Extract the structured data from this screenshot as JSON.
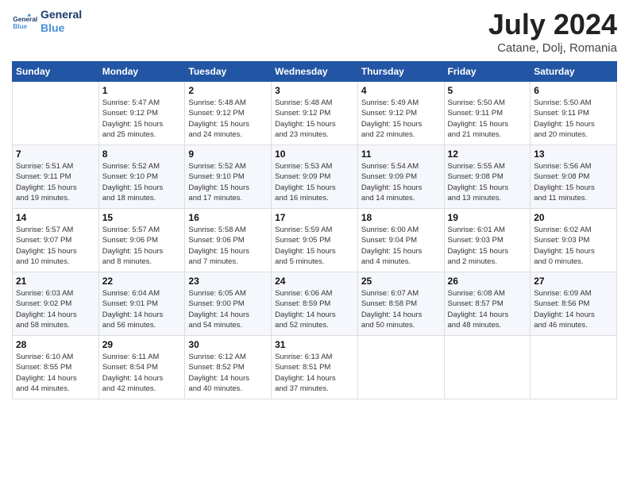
{
  "header": {
    "logo_line1": "General",
    "logo_line2": "Blue",
    "month_year": "July 2024",
    "location": "Catane, Dolj, Romania"
  },
  "days_of_week": [
    "Sunday",
    "Monday",
    "Tuesday",
    "Wednesday",
    "Thursday",
    "Friday",
    "Saturday"
  ],
  "weeks": [
    [
      {
        "num": "",
        "info": ""
      },
      {
        "num": "1",
        "info": "Sunrise: 5:47 AM\nSunset: 9:12 PM\nDaylight: 15 hours\nand 25 minutes."
      },
      {
        "num": "2",
        "info": "Sunrise: 5:48 AM\nSunset: 9:12 PM\nDaylight: 15 hours\nand 24 minutes."
      },
      {
        "num": "3",
        "info": "Sunrise: 5:48 AM\nSunset: 9:12 PM\nDaylight: 15 hours\nand 23 minutes."
      },
      {
        "num": "4",
        "info": "Sunrise: 5:49 AM\nSunset: 9:12 PM\nDaylight: 15 hours\nand 22 minutes."
      },
      {
        "num": "5",
        "info": "Sunrise: 5:50 AM\nSunset: 9:11 PM\nDaylight: 15 hours\nand 21 minutes."
      },
      {
        "num": "6",
        "info": "Sunrise: 5:50 AM\nSunset: 9:11 PM\nDaylight: 15 hours\nand 20 minutes."
      }
    ],
    [
      {
        "num": "7",
        "info": "Sunrise: 5:51 AM\nSunset: 9:11 PM\nDaylight: 15 hours\nand 19 minutes."
      },
      {
        "num": "8",
        "info": "Sunrise: 5:52 AM\nSunset: 9:10 PM\nDaylight: 15 hours\nand 18 minutes."
      },
      {
        "num": "9",
        "info": "Sunrise: 5:52 AM\nSunset: 9:10 PM\nDaylight: 15 hours\nand 17 minutes."
      },
      {
        "num": "10",
        "info": "Sunrise: 5:53 AM\nSunset: 9:09 PM\nDaylight: 15 hours\nand 16 minutes."
      },
      {
        "num": "11",
        "info": "Sunrise: 5:54 AM\nSunset: 9:09 PM\nDaylight: 15 hours\nand 14 minutes."
      },
      {
        "num": "12",
        "info": "Sunrise: 5:55 AM\nSunset: 9:08 PM\nDaylight: 15 hours\nand 13 minutes."
      },
      {
        "num": "13",
        "info": "Sunrise: 5:56 AM\nSunset: 9:08 PM\nDaylight: 15 hours\nand 11 minutes."
      }
    ],
    [
      {
        "num": "14",
        "info": "Sunrise: 5:57 AM\nSunset: 9:07 PM\nDaylight: 15 hours\nand 10 minutes."
      },
      {
        "num": "15",
        "info": "Sunrise: 5:57 AM\nSunset: 9:06 PM\nDaylight: 15 hours\nand 8 minutes."
      },
      {
        "num": "16",
        "info": "Sunrise: 5:58 AM\nSunset: 9:06 PM\nDaylight: 15 hours\nand 7 minutes."
      },
      {
        "num": "17",
        "info": "Sunrise: 5:59 AM\nSunset: 9:05 PM\nDaylight: 15 hours\nand 5 minutes."
      },
      {
        "num": "18",
        "info": "Sunrise: 6:00 AM\nSunset: 9:04 PM\nDaylight: 15 hours\nand 4 minutes."
      },
      {
        "num": "19",
        "info": "Sunrise: 6:01 AM\nSunset: 9:03 PM\nDaylight: 15 hours\nand 2 minutes."
      },
      {
        "num": "20",
        "info": "Sunrise: 6:02 AM\nSunset: 9:03 PM\nDaylight: 15 hours\nand 0 minutes."
      }
    ],
    [
      {
        "num": "21",
        "info": "Sunrise: 6:03 AM\nSunset: 9:02 PM\nDaylight: 14 hours\nand 58 minutes."
      },
      {
        "num": "22",
        "info": "Sunrise: 6:04 AM\nSunset: 9:01 PM\nDaylight: 14 hours\nand 56 minutes."
      },
      {
        "num": "23",
        "info": "Sunrise: 6:05 AM\nSunset: 9:00 PM\nDaylight: 14 hours\nand 54 minutes."
      },
      {
        "num": "24",
        "info": "Sunrise: 6:06 AM\nSunset: 8:59 PM\nDaylight: 14 hours\nand 52 minutes."
      },
      {
        "num": "25",
        "info": "Sunrise: 6:07 AM\nSunset: 8:58 PM\nDaylight: 14 hours\nand 50 minutes."
      },
      {
        "num": "26",
        "info": "Sunrise: 6:08 AM\nSunset: 8:57 PM\nDaylight: 14 hours\nand 48 minutes."
      },
      {
        "num": "27",
        "info": "Sunrise: 6:09 AM\nSunset: 8:56 PM\nDaylight: 14 hours\nand 46 minutes."
      }
    ],
    [
      {
        "num": "28",
        "info": "Sunrise: 6:10 AM\nSunset: 8:55 PM\nDaylight: 14 hours\nand 44 minutes."
      },
      {
        "num": "29",
        "info": "Sunrise: 6:11 AM\nSunset: 8:54 PM\nDaylight: 14 hours\nand 42 minutes."
      },
      {
        "num": "30",
        "info": "Sunrise: 6:12 AM\nSunset: 8:52 PM\nDaylight: 14 hours\nand 40 minutes."
      },
      {
        "num": "31",
        "info": "Sunrise: 6:13 AM\nSunset: 8:51 PM\nDaylight: 14 hours\nand 37 minutes."
      },
      {
        "num": "",
        "info": ""
      },
      {
        "num": "",
        "info": ""
      },
      {
        "num": "",
        "info": ""
      }
    ]
  ]
}
